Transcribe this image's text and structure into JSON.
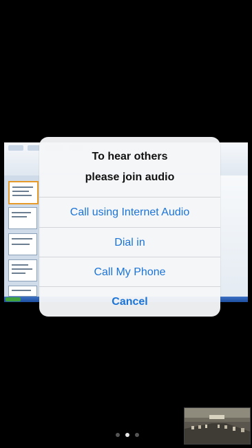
{
  "dialog": {
    "title_line1": "To hear others",
    "title_line2": "please join audio",
    "actions": [
      {
        "label": "Call using Internet Audio"
      },
      {
        "label": "Dial in"
      },
      {
        "label": "Call My Phone"
      }
    ],
    "cancel_label": "Cancel"
  },
  "page_indicator": {
    "count": 3,
    "active_index": 1
  },
  "colors": {
    "accent": "#1a74d8",
    "background": "#000000"
  }
}
